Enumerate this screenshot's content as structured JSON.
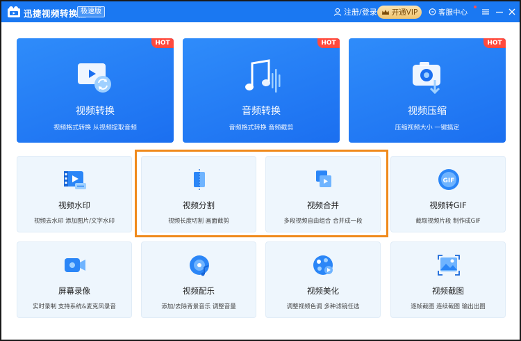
{
  "window": {
    "title": "迅捷视频转换器",
    "edition": "极速版",
    "user_label": "注册/登录",
    "vip_label": "开通VIP",
    "service_label": "客服中心"
  },
  "features_main": [
    {
      "title": "视频转换",
      "desc": "视频格式转换 从视频提取音频",
      "badge": "HOT",
      "icon": "video-convert-icon"
    },
    {
      "title": "音频转换",
      "desc": "音频格式转换 音频截剪",
      "badge": "HOT",
      "icon": "audio-convert-icon"
    },
    {
      "title": "视频压缩",
      "desc": "压缩视频大小 一键搞定",
      "badge": "HOT",
      "icon": "video-compress-icon"
    }
  ],
  "features_tools": [
    {
      "title": "视频水印",
      "desc": "视频去水印 添加图片/文字水印",
      "icon": "video-watermark-icon"
    },
    {
      "title": "视频分割",
      "desc": "视频长度切割 画面截剪",
      "icon": "video-split-icon"
    },
    {
      "title": "视频合并",
      "desc": "多段视频自由组合 合并成一段",
      "icon": "video-merge-icon"
    },
    {
      "title": "视频转GIF",
      "desc": "截取视频片段 制作成GIF",
      "icon": "video-to-gif-icon"
    },
    {
      "title": "屏幕录像",
      "desc": "实时录制 支持系统&麦克风录音",
      "icon": "screen-record-icon"
    },
    {
      "title": "视频配乐",
      "desc": "添加/去除背景音乐 调整音量",
      "icon": "video-music-icon"
    },
    {
      "title": "视频美化",
      "desc": "调整视频色调 多种滤镜任选",
      "icon": "video-beautify-icon"
    },
    {
      "title": "视频截图",
      "desc": "逐帧截图 连续截图 输出出图",
      "icon": "video-screenshot-icon"
    }
  ],
  "gif_badge_text": "GIF",
  "colors": {
    "titlebar": "#1a78f2",
    "card_blue": "#1b6ff0",
    "hot_red": "#ff4a3d",
    "highlight_orange": "#f08a1c",
    "tool_card_bg": "#eef6fd"
  }
}
